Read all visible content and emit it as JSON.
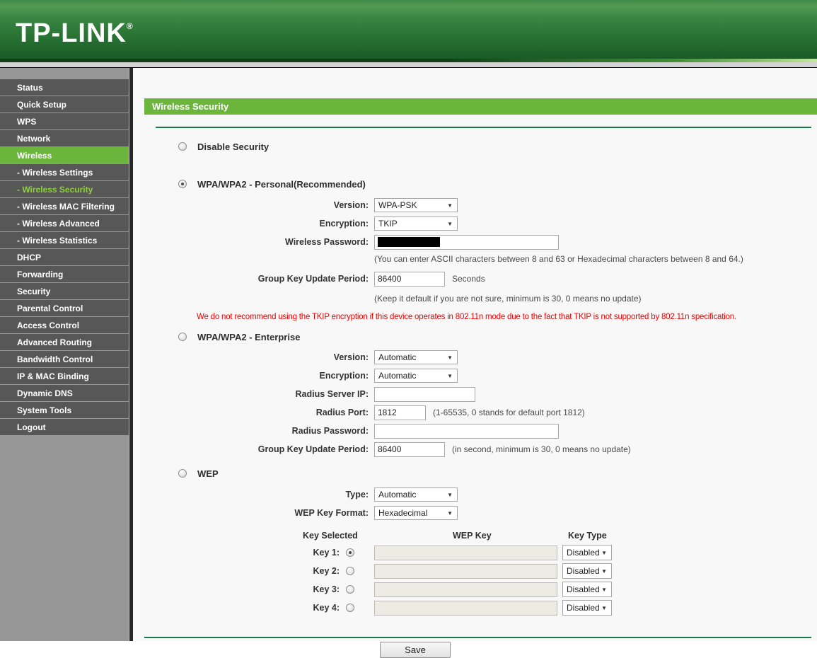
{
  "header": {
    "logo": "TP-LINK",
    "registered_mark": "®"
  },
  "sidebar": {
    "items": [
      {
        "label": "Status"
      },
      {
        "label": "Quick Setup"
      },
      {
        "label": "WPS"
      },
      {
        "label": "Network"
      },
      {
        "label": "Wireless",
        "state": "active"
      },
      {
        "label": "- Wireless Settings"
      },
      {
        "label": "- Wireless Security",
        "state": "sub-active"
      },
      {
        "label": "- Wireless MAC Filtering"
      },
      {
        "label": "- Wireless Advanced"
      },
      {
        "label": "- Wireless Statistics"
      },
      {
        "label": "DHCP"
      },
      {
        "label": "Forwarding"
      },
      {
        "label": "Security"
      },
      {
        "label": "Parental Control"
      },
      {
        "label": "Access Control"
      },
      {
        "label": "Advanced Routing"
      },
      {
        "label": "Bandwidth Control"
      },
      {
        "label": "IP & MAC Binding"
      },
      {
        "label": "Dynamic DNS"
      },
      {
        "label": "System Tools"
      },
      {
        "label": "Logout"
      }
    ]
  },
  "main": {
    "title": "Wireless Security",
    "disable": {
      "label": "Disable Security",
      "checked": false
    },
    "personal": {
      "label": "WPA/WPA2 - Personal(Recommended)",
      "checked": true,
      "version_label": "Version:",
      "version_value": "WPA-PSK",
      "encryption_label": "Encryption:",
      "encryption_value": "TKIP",
      "password_label": "Wireless Password:",
      "password_value": "",
      "password_note": "(You can enter ASCII characters between 8 and 63 or Hexadecimal characters between 8 and 64.)",
      "gkup_label": "Group Key Update Period:",
      "gkup_value": "86400",
      "gkup_unit": "Seconds",
      "gkup_note": "(Keep it default if you are not sure, minimum is 30, 0 means no update)"
    },
    "warning": "We do not recommend using the TKIP encryption if this device operates in 802.11n mode due to the fact that TKIP is not supported by 802.11n specification.",
    "enterprise": {
      "label": "WPA/WPA2 - Enterprise",
      "checked": false,
      "version_label": "Version:",
      "version_value": "Automatic",
      "encryption_label": "Encryption:",
      "encryption_value": "Automatic",
      "radius_ip_label": "Radius Server IP:",
      "radius_ip_value": "",
      "radius_port_label": "Radius Port:",
      "radius_port_value": "1812",
      "radius_port_note": "(1-65535, 0 stands for default port 1812)",
      "radius_pwd_label": "Radius Password:",
      "radius_pwd_value": "",
      "gkup_label": "Group Key Update Period:",
      "gkup_value": "86400",
      "gkup_note": "(in second, minimum is 30, 0 means no update)"
    },
    "wep": {
      "label": "WEP",
      "checked": false,
      "type_label": "Type:",
      "type_value": "Automatic",
      "format_label": "WEP Key Format:",
      "format_value": "Hexadecimal",
      "col_key_selected": "Key Selected",
      "col_wep_key": "WEP Key",
      "col_key_type": "Key Type",
      "keys": [
        {
          "label": "Key 1:",
          "selected": true,
          "value": "",
          "type": "Disabled"
        },
        {
          "label": "Key 2:",
          "selected": false,
          "value": "",
          "type": "Disabled"
        },
        {
          "label": "Key 3:",
          "selected": false,
          "value": "",
          "type": "Disabled"
        },
        {
          "label": "Key 4:",
          "selected": false,
          "value": "",
          "type": "Disabled"
        }
      ]
    },
    "save_label": "Save"
  },
  "icons": {
    "dropdown_arrow": "▼"
  },
  "colors": {
    "brand_green_dark": "#1f632a",
    "accent_green": "#6cb53d",
    "subactive_green": "#8ed13f",
    "rule_green": "#1a7a4a",
    "warning_red": "#f00000",
    "sidebar_item": "#575757",
    "sidebar_bg": "#969696"
  }
}
